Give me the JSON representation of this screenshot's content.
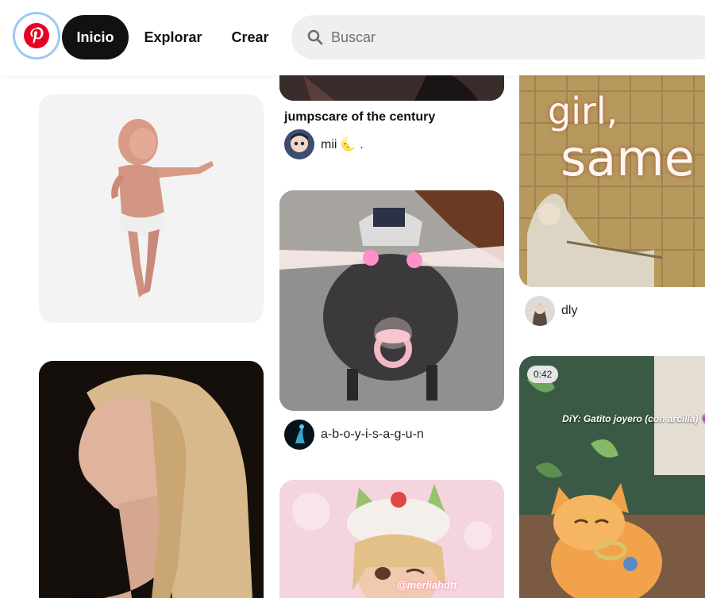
{
  "header": {
    "logo_alt": "Pinterest",
    "nav": {
      "home": "Inicio",
      "explore": "Explorar",
      "create": "Crear"
    },
    "search": {
      "placeholder": "Buscar",
      "value": ""
    }
  },
  "pins": {
    "baby": {},
    "ariana": {},
    "jumpscare": {
      "title": "jumpscare of the century",
      "user": "mii 🌜 ."
    },
    "pig": {
      "user": "a-b-o-y-i-s-a-g-u-n"
    },
    "doll": {
      "watermark": "@merliahdtt"
    },
    "girl_same": {
      "text_line1": "girl,",
      "text_line2": "same",
      "user": "dly"
    },
    "kitten_video": {
      "duration": "0:42",
      "caption": "DiY: Gatito joyero (con arcilla) 💜"
    }
  },
  "colors": {
    "brand": "#e60023",
    "active_nav_bg": "#111111",
    "search_bg": "#efefef",
    "focus_ring": "#9ec9f2"
  }
}
